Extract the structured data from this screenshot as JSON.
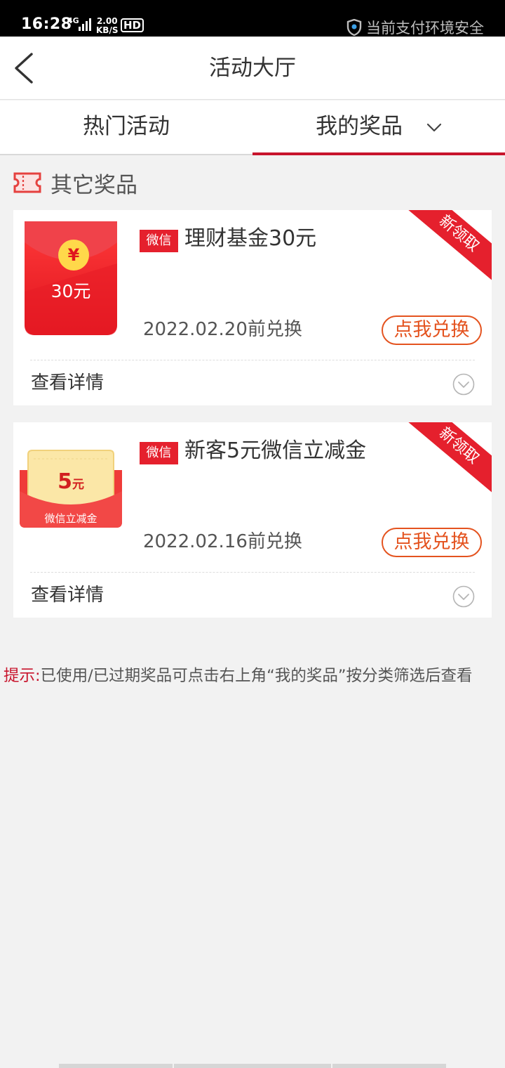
{
  "status_bar": {
    "time": "16:28",
    "network": "4G",
    "speed_value": "2.00",
    "speed_unit": "KB/S",
    "hd": "HD",
    "security_text": "当前支付环境安全"
  },
  "header": {
    "title": "活动大厅",
    "back_icon": "chevron-left-icon"
  },
  "tabs": [
    {
      "label": "热门活动",
      "active": false
    },
    {
      "label": "我的奖品",
      "active": true,
      "icon": "chevron-down-icon"
    }
  ],
  "section": {
    "title": "其它奖品",
    "icon": "ticket-icon"
  },
  "prizes": [
    {
      "thumb_label": "30元",
      "thumb_symbol": "¥",
      "tag": "微信",
      "name": "理财基金30元",
      "ribbon": "新领取",
      "deadline": "2022.02.20前兑换",
      "action": "点我兑换",
      "detail": "查看详情"
    },
    {
      "thumb_value": "5",
      "thumb_unit": "元",
      "thumb_caption": "微信立减金",
      "tag": "微信",
      "name": "新客5元微信立减金",
      "ribbon": "新领取",
      "deadline": "2022.02.16前兑换",
      "action": "点我兑换",
      "detail": "查看详情"
    }
  ],
  "hint": {
    "label": "提示:",
    "text": "已使用/已过期奖品可点击右上角“我的奖品”按分类筛选后查看"
  },
  "colors": {
    "accent_red": "#c8152d",
    "tag_red": "#e5202d",
    "action_orange": "#e4531f",
    "background": "#f2f2f2"
  }
}
